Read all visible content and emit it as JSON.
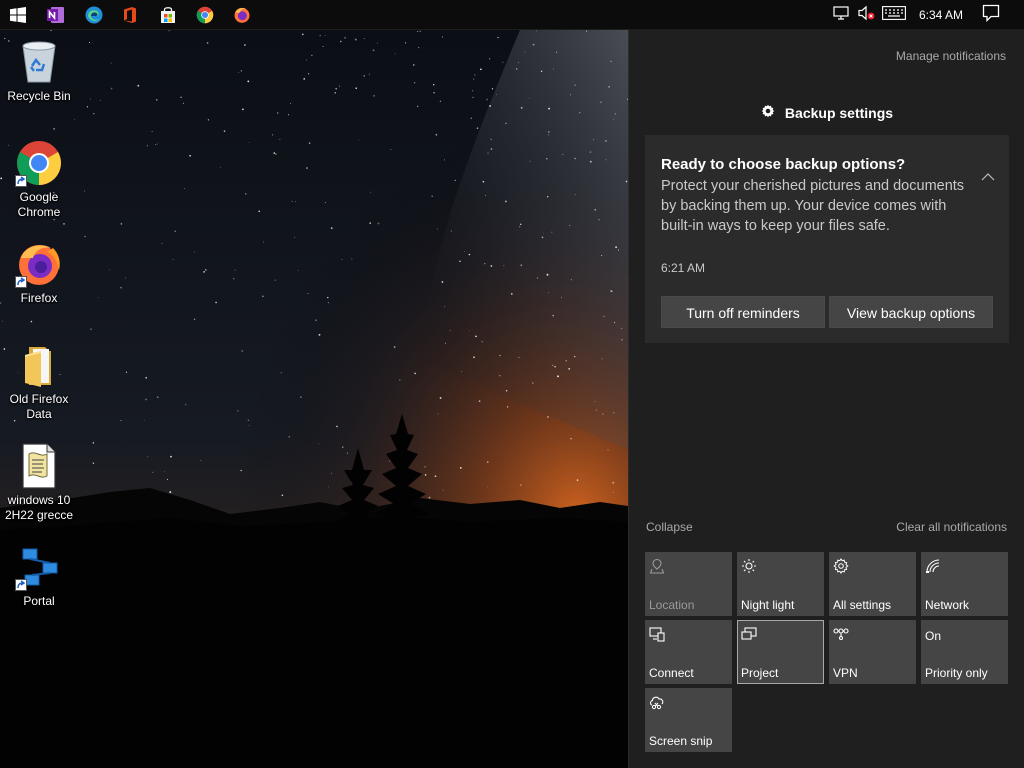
{
  "taskbar": {
    "pinned": [
      {
        "name": "start-button",
        "icon": "windows-logo-icon"
      },
      {
        "name": "onenote",
        "icon": "onenote-icon"
      },
      {
        "name": "edge",
        "icon": "edge-icon"
      },
      {
        "name": "office",
        "icon": "office-icon"
      },
      {
        "name": "store",
        "icon": "store-icon"
      },
      {
        "name": "chrome",
        "icon": "chrome-icon"
      },
      {
        "name": "firefox",
        "icon": "firefox-icon"
      }
    ],
    "tray_icons": [
      "network-icon",
      "volume-muted-icon",
      "touch-keyboard-icon"
    ],
    "clock": "6:34 AM",
    "action_center_icon": "notifications-icon"
  },
  "desktop": {
    "icons": [
      {
        "label": "Recycle Bin",
        "icon": "recycle-bin-icon"
      },
      {
        "label": "Google Chrome",
        "icon": "chrome-icon"
      },
      {
        "label": "Firefox",
        "icon": "firefox-icon"
      },
      {
        "label": "Old Firefox Data",
        "icon": "folder-icon"
      },
      {
        "label": "windows 10 2H22 grecce",
        "icon": "script-file-icon"
      },
      {
        "label": "Portal",
        "icon": "portal-icon"
      }
    ]
  },
  "action_center": {
    "manage_notifications": "Manage notifications",
    "app_header": {
      "name": "Backup settings",
      "icon": "gear-icon"
    },
    "toast": {
      "title": "Ready to choose backup options?",
      "body": "Protect your cherished pictures and documents by backing them up. Your device comes with built-in ways to keep your files safe.",
      "time": "6:21 AM",
      "buttons": [
        "Turn off reminders",
        "View backup options"
      ]
    },
    "collapse": "Collapse",
    "clear_all": "Clear all notifications",
    "quick_actions": [
      {
        "label": "Location",
        "icon": "location-icon",
        "state": "disabled"
      },
      {
        "label": "Night light",
        "icon": "night-light-icon",
        "state": "off"
      },
      {
        "label": "All settings",
        "icon": "settings-icon",
        "state": "off"
      },
      {
        "label": "Network",
        "icon": "network-icon",
        "state": "off"
      },
      {
        "label": "Connect",
        "icon": "connect-icon",
        "state": "off"
      },
      {
        "label": "Project",
        "icon": "project-icon",
        "state": "selected"
      },
      {
        "label": "VPN",
        "icon": "vpn-icon",
        "state": "off"
      },
      {
        "label": "Priority only",
        "top_text": "On",
        "state": "off"
      },
      {
        "label": "Screen snip",
        "icon": "screen-snip-icon",
        "state": "off"
      }
    ]
  },
  "colors": {
    "taskbar_bg": "#0c0c0c",
    "action_center_bg": "#1f1f1f",
    "toast_bg": "#2b2b2b",
    "tile_bg": "#454545",
    "link_text": "#a9a9a9"
  }
}
